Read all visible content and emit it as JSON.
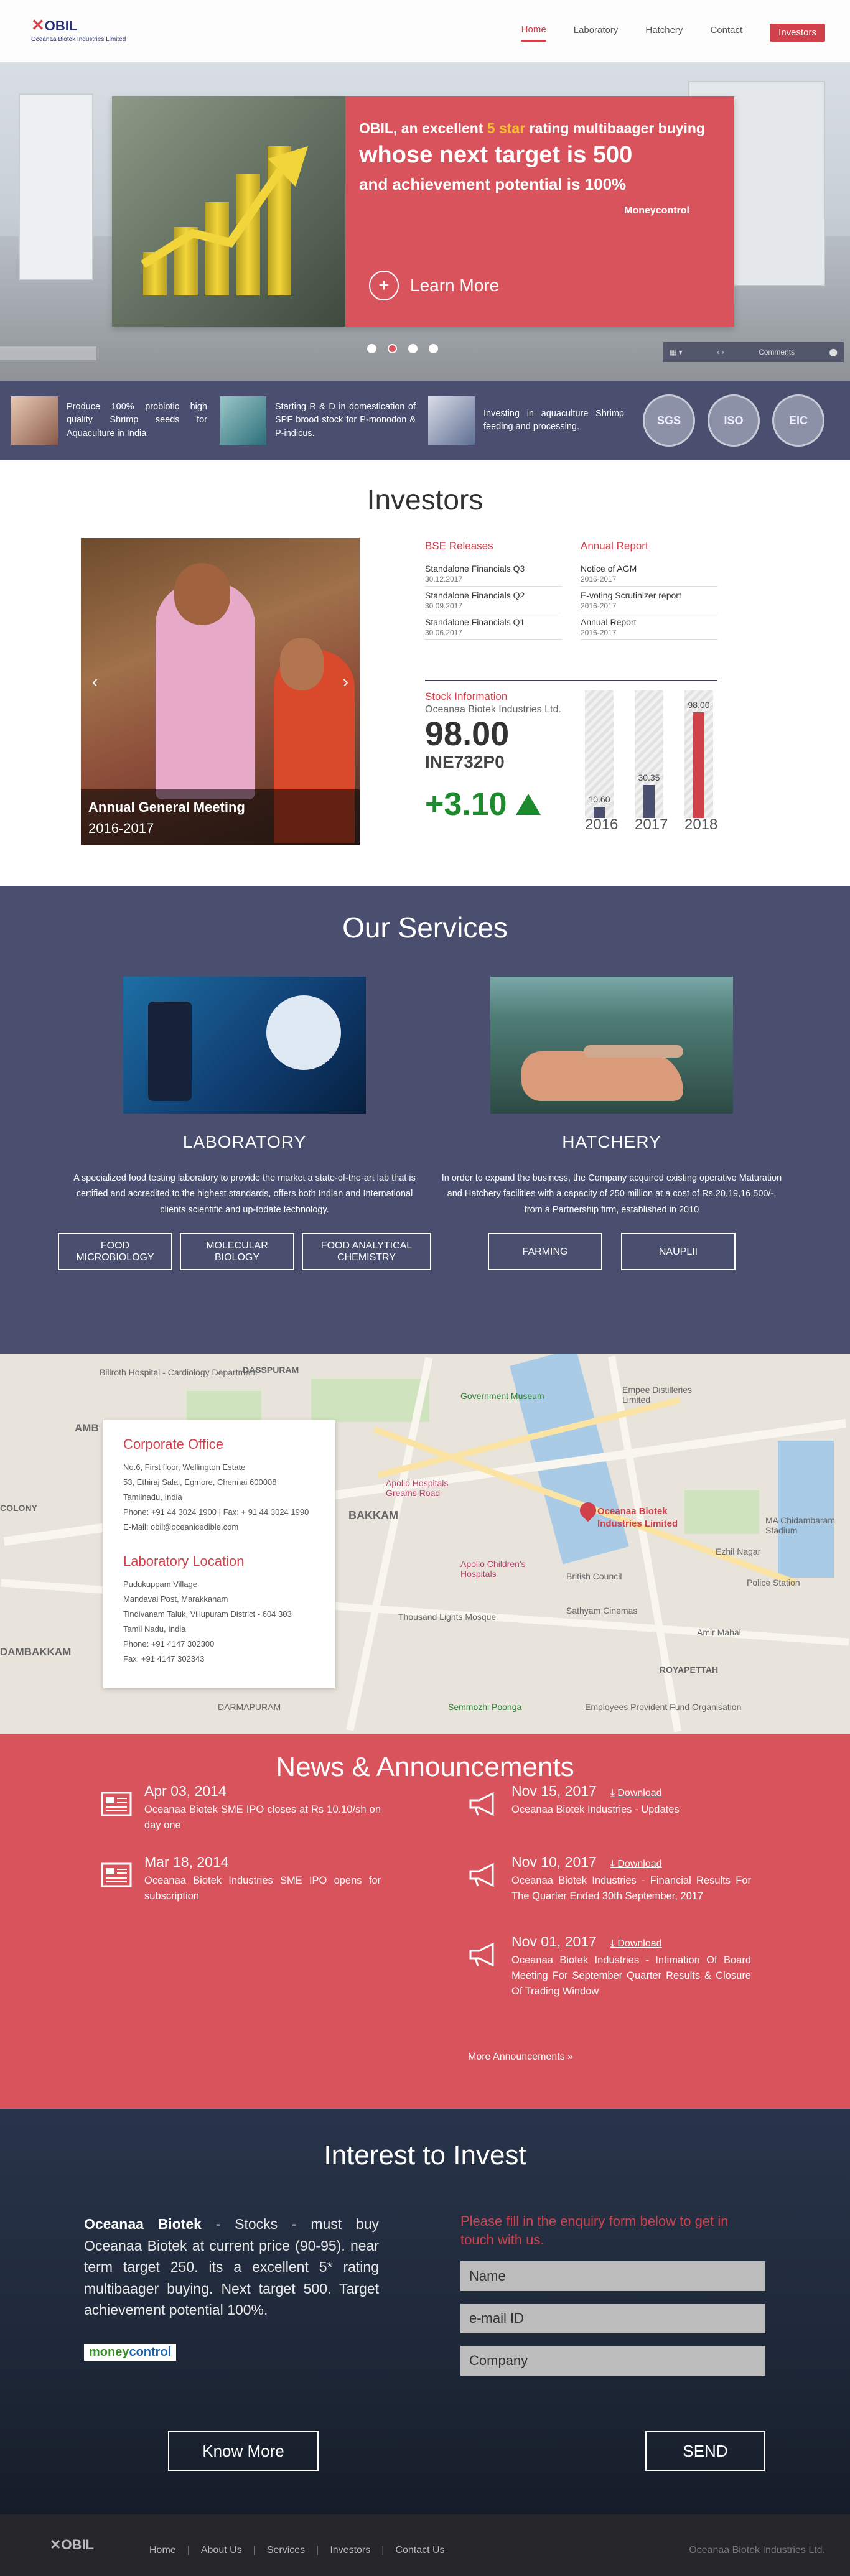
{
  "header": {
    "logo_text": "OBIL",
    "logo_sub": "Oceanaa Biotek Industries Limited",
    "nav": [
      "Home",
      "Laboratory",
      "Hatchery",
      "Contact"
    ],
    "investors_btn": "Investors"
  },
  "hero": {
    "line1_a": "OBIL, an excellent ",
    "line1_star": "5 star",
    "line1_b": " rating multibaager buying",
    "line2": "whose next target is 500",
    "line3": "and achievement potential is 100%",
    "source": "Moneycontrol",
    "cta": "Learn More",
    "comments": "Comments",
    "slides": 4,
    "active_slide": 1
  },
  "features": [
    {
      "text": "Produce 100% probiotic high quality Shrimp seeds for Aquaculture in India"
    },
    {
      "text": "Starting R & D in domestication of SPF brood stock for P-monodon & P-indicus."
    },
    {
      "text": "Investing in aquaculture Shrimp feeding and processing."
    }
  ],
  "certs": [
    "SGS",
    "ISO",
    "EIC"
  ],
  "investors": {
    "title": "Investors",
    "agm_title": "Annual General Meeting",
    "agm_year": "2016-2017",
    "bse": {
      "heading": "BSE Releases",
      "items": [
        {
          "title": "Standalone Financials Q3",
          "date": "30.12.2017"
        },
        {
          "title": "Standalone Financials Q2",
          "date": "30.09.2017"
        },
        {
          "title": "Standalone Financials Q1",
          "date": "30.06.2017"
        }
      ]
    },
    "annual": {
      "heading": "Annual Report",
      "items": [
        {
          "title": "Notice of AGM",
          "date": "2016-2017"
        },
        {
          "title": "E-voting Scrutinizer report",
          "date": "2016-2017"
        },
        {
          "title": "Annual Report",
          "date": "2016-2017"
        }
      ]
    },
    "stock": {
      "heading": "Stock Information",
      "company": "Oceanaa Biotek Industries Ltd.",
      "price": "98.00",
      "isin": "INE732P0",
      "change": "+3.10"
    }
  },
  "chart_data": {
    "type": "bar",
    "categories": [
      "2016",
      "2017",
      "2018"
    ],
    "values": [
      10.6,
      30.35,
      98.0
    ],
    "value_labels": [
      "10.60",
      "30.35",
      "98.00"
    ],
    "colors": [
      "#4a4f70",
      "#4a4f70",
      "#d0414c"
    ],
    "ylim": [
      0,
      98
    ]
  },
  "services": {
    "title": "Our Services",
    "lab": {
      "title": "LABORATORY",
      "desc": "A specialized food testing laboratory to provide the market a state-of-the-art lab that is certified and accredited to the highest standards, offers both Indian and International clients scientific and up-todate technology.",
      "buttons": [
        "FOOD MICROBIOLOGY",
        "MOLECULAR BIOLOGY",
        "FOOD ANALYTICAL CHEMISTRY"
      ]
    },
    "hatch": {
      "title": "HATCHERY",
      "desc": "In order to expand the business, the Company acquired existing operative Maturation and Hatchery facilities with a capacity of 250 million at a cost of Rs.20,19,16,500/-, from a Partnership firm, established in 2010",
      "buttons": [
        "FARMING",
        "NAUPLII"
      ]
    }
  },
  "contact": {
    "corp_heading": "Corporate Office",
    "corp_lines": [
      "No.6, First floor, Wellington Estate",
      "53, Ethiraj Salai, Egmore, Chennai 600008",
      "Tamilnadu, India",
      "Phone: +91 44 3024 1900 | Fax: + 91 44 3024 1990",
      "E-Mail: obil@oceanicedible.com"
    ],
    "lab_heading": "Laboratory Location",
    "lab_lines": [
      "Pudukuppam Village",
      "Mandavai Post, Marakkanam",
      "Tindivanam Taluk, Villupuram District - 604 303",
      "Tamil Nadu, India",
      "Phone: +91 4147 302300",
      "Fax: +91 4147 302343"
    ],
    "map_pin": "Oceanaa Biotek Industries Limited",
    "map_labels": [
      "DASSPURAM",
      "Government Museum",
      "Empee Distilleries Limited",
      "BAKKAM",
      "DAMBAKKAM",
      "Apollo Hospitals Greams Road",
      "Apollo Children's Hospitals",
      "Thousand Lights Mosque",
      "Sathyam Cinemas",
      "ROYAPETTAH",
      "DARMAPURAM",
      "Semmozhi Poonga",
      "Employees Provident Fund Organisation",
      "Police Station",
      "MA Chidambaram Stadium",
      "Billroth Hospital - Cardiology Department",
      "British Council",
      "Amir Mahal",
      "Ezhil Nagar",
      "COLONY",
      "AMB"
    ]
  },
  "news": {
    "title": "News & Announcements",
    "left": [
      {
        "date": "Apr 03, 2014",
        "text": "Oceanaa Biotek SME IPO closes at Rs 10.10/sh on day one"
      },
      {
        "date": "Mar 18, 2014",
        "text": "Oceanaa Biotek Industries SME IPO opens for subscription"
      }
    ],
    "right": [
      {
        "date": "Nov 15, 2017",
        "download": "Download",
        "text": "Oceanaa Biotek Industries - Updates"
      },
      {
        "date": "Nov 10, 2017",
        "download": "Download",
        "text": "Oceanaa Biotek Industries - Financial Results For The Quarter Ended 30th September, 2017"
      },
      {
        "date": "Nov 01, 2017",
        "download": "Download",
        "text": "Oceanaa Biotek Industries - Intimation Of Board Meeting For September Quarter Results & Closure Of Trading Window"
      }
    ],
    "more": "More Announcements »"
  },
  "invest": {
    "title": "Interest to Invest",
    "brand": "Oceanaa Biotek",
    "text": " - Stocks - must buy Oceanaa Biotek at current price (90-95). near term target 250. its a excellent 5* rating multibaager buying. Next target 500. Target achievement potential 100%.",
    "mc_a": "money",
    "mc_b": "control",
    "form_label": "Please fill in the enquiry form below to get in touch with us.",
    "fields": [
      "Name",
      "e-mail ID",
      "Company"
    ],
    "know_more": "Know More",
    "send": "SEND"
  },
  "footer": {
    "logo": "OBIL",
    "links": [
      "Home",
      "About Us",
      "Services",
      "Investors",
      "Contact Us"
    ],
    "copyright": "Oceanaa Biotek Industries Ltd."
  }
}
